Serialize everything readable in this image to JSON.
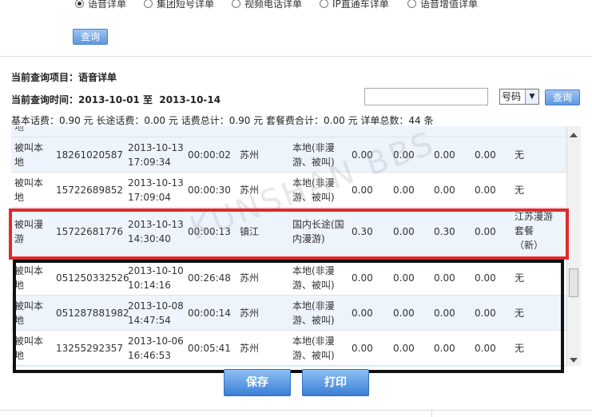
{
  "query_types": [
    {
      "label": "语音详单",
      "selected": true
    },
    {
      "label": "集团短号详单",
      "selected": false
    },
    {
      "label": "视频电话详单",
      "selected": false
    },
    {
      "label": "IP直通车详单",
      "selected": false
    },
    {
      "label": "语音增值详单",
      "selected": false
    }
  ],
  "query_button": "查询",
  "current_item": "当前查询项目：语音详单",
  "current_time_label": "当前查询时间：",
  "date_from": "2013-10-01",
  "date_to_label": "至",
  "date_to": "2013-10-14",
  "search": {
    "value": "",
    "select_value": "号码",
    "button": "查询"
  },
  "summary": "基本话费：0.90 元 长途话费：0.00 元 话费总计：0.90 元 套餐费合计：0.00 元 详单总数：44 条",
  "rows": [
    {
      "type": [
        "被叫本",
        "地"
      ],
      "number": "18261020587",
      "date": "2013-10-13",
      "time": "17:09:34",
      "duration": "00:00:02",
      "place": "苏州",
      "category": [
        "本地(非漫",
        "游、被叫)"
      ],
      "f1": "0.00",
      "f2": "0.00",
      "f3": "0.00",
      "f4": "0.00",
      "pkg": [
        "无"
      ]
    },
    {
      "type": [
        "被叫本",
        "地"
      ],
      "number": "15722689852",
      "date": "2013-10-13",
      "time": "17:09:04",
      "duration": "00:00:30",
      "place": "苏州",
      "category": [
        "本地(非漫",
        "游、被叫)"
      ],
      "f1": "0.00",
      "f2": "0.00",
      "f3": "0.00",
      "f4": "0.00",
      "pkg": [
        "无"
      ]
    },
    {
      "type": [
        "被叫漫",
        "游"
      ],
      "number": "15722681776",
      "date": "2013-10-13",
      "time": "14:30:40",
      "duration": "00:00:13",
      "place": "镇江",
      "category": [
        "国内长途(国",
        "内漫游)"
      ],
      "f1": "0.30",
      "f2": "0.00",
      "f3": "0.30",
      "f4": "0.00",
      "pkg": [
        "江苏漫游",
        "套餐",
        "（新）"
      ]
    },
    {
      "type": [
        "被叫本",
        "地"
      ],
      "number": "051250332526",
      "date": "2013-10-10",
      "time": "10:14:16",
      "duration": "00:26:48",
      "place": "苏州",
      "category": [
        "本地(非漫",
        "游、被叫)"
      ],
      "f1": "0.00",
      "f2": "0.00",
      "f3": "0.00",
      "f4": "0.00",
      "pkg": [
        "无"
      ]
    },
    {
      "type": [
        "被叫本",
        "地"
      ],
      "number": "051287881982",
      "date": "2013-10-08",
      "time": "14:47:54",
      "duration": "00:00:14",
      "place": "苏州",
      "category": [
        "本地(非漫",
        "游、被叫)"
      ],
      "f1": "0.00",
      "f2": "0.00",
      "f3": "0.00",
      "f4": "0.00",
      "pkg": [
        "无"
      ]
    },
    {
      "type": [
        "被叫本",
        "地"
      ],
      "number": "13255292357",
      "date": "2013-10-06",
      "time": "16:46:53",
      "duration": "00:05:41",
      "place": "苏州",
      "category": [
        "本地(非漫",
        "游、被叫)"
      ],
      "f1": "0.00",
      "f2": "0.00",
      "f3": "0.00",
      "f4": "0.00",
      "pkg": [
        "无"
      ]
    }
  ],
  "save_button": "保存",
  "print_button": "打印"
}
